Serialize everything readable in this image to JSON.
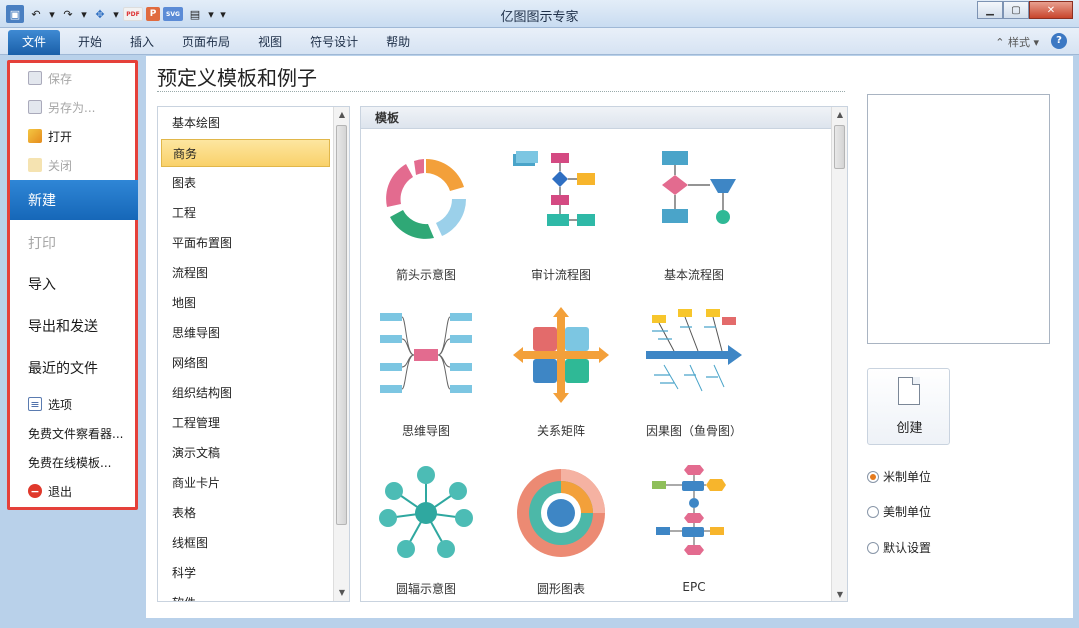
{
  "window": {
    "title": "亿图图示专家"
  },
  "qat": {
    "pdf": "PDF",
    "ppt": "P",
    "svg": "SVG"
  },
  "ribbon": {
    "tabs": [
      "文件",
      "开始",
      "插入",
      "页面布局",
      "视图",
      "符号设计",
      "帮助"
    ],
    "style_label": "样式"
  },
  "backstage": {
    "items": [
      {
        "label": "保存",
        "disabled": true
      },
      {
        "label": "另存为...",
        "disabled": true
      },
      {
        "label": "打开",
        "disabled": false
      },
      {
        "label": "关闭",
        "disabled": true
      },
      {
        "label": "新建",
        "active": true
      },
      {
        "label": "打印",
        "disabled": true
      },
      {
        "label": "导入"
      },
      {
        "label": "导出和发送"
      },
      {
        "label": "最近的文件"
      },
      {
        "label": "选项"
      },
      {
        "label": "免费文件察看器..."
      },
      {
        "label": "免费在线模板..."
      },
      {
        "label": "退出"
      }
    ]
  },
  "main": {
    "heading": "预定义模板和例子",
    "categories": [
      "基本绘图",
      "商务",
      "图表",
      "工程",
      "平面布置图",
      "流程图",
      "地图",
      "思维导图",
      "网络图",
      "组织结构图",
      "工程管理",
      "演示文稿",
      "商业卡片",
      "表格",
      "线框图",
      "科学",
      "软件"
    ],
    "selected_category": "商务",
    "templates_header": "模板",
    "templates": [
      {
        "label": "箭头示意图",
        "icon": "arrow-cycle-icon"
      },
      {
        "label": "审计流程图",
        "icon": "audit-flowchart-icon"
      },
      {
        "label": "基本流程图",
        "icon": "basic-flowchart-icon"
      },
      {
        "label": "思维导图",
        "icon": "mindmap-icon"
      },
      {
        "label": "关系矩阵",
        "icon": "relation-matrix-icon"
      },
      {
        "label": "因果图（鱼骨图）",
        "icon": "fishbone-icon"
      },
      {
        "label": "圆辐示意图",
        "icon": "radial-spoke-icon"
      },
      {
        "label": "圆形图表",
        "icon": "circular-chart-icon"
      },
      {
        "label": "EPC",
        "icon": "epc-icon"
      }
    ]
  },
  "right_panel": {
    "create_label": "创建",
    "units": [
      {
        "label": "米制单位",
        "checked": true
      },
      {
        "label": "美制单位",
        "checked": false
      },
      {
        "label": "默认设置",
        "checked": false
      }
    ]
  }
}
